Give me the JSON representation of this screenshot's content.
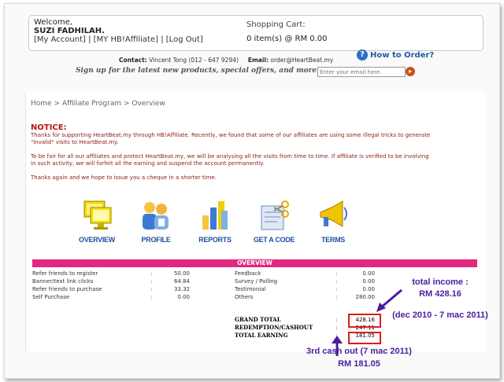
{
  "header": {
    "welcome": "Welcome,",
    "user": "SUZI FADHILAH.",
    "links": [
      "[My Account]",
      "[MY HB!Affiliate]",
      "[Log Out]"
    ],
    "link_sep": "|",
    "cart_title": "Shopping Cart:",
    "cart_summary": "0 item(s) @ RM 0.00"
  },
  "contact": {
    "label": "Contact:",
    "value": "Vincent Tong (012 - 647 9294)",
    "email_label": "Email:",
    "email": "order@HeartBeat.my"
  },
  "how_to_order": "How to Order?",
  "signup": {
    "text": "Sign up for the latest new products, special offers, and more:",
    "placeholder": "Enter your email here."
  },
  "breadcrumb": "Home > Affiliate Program > Overview",
  "notice": {
    "title": "NOTICE:",
    "p1": "Thanks for supporting HeartBeat.my through HB!Affiliate. Recently, we found that some of our affiliates are using some illegal tricks to generate \"invalid\" visits to HeartBeat.my.",
    "p2": "To be fair for all our affiliates and protect HeartBeat.my, we will be analysing all the visits from time to time. If affiliate is verified to be involving in such activity, we will forfeit all the earning and suspend the account permanently.",
    "p3": "Thanks again and we hope to issue you a cheque in a shorter time."
  },
  "nav": {
    "overview": "OVERVIEW",
    "profile": "PROFILE",
    "reports": "REPORTS",
    "get_code": "GET A CODE",
    "terms": "TERMS"
  },
  "overview": {
    "title": "OVERVIEW",
    "colon": ":",
    "left": [
      {
        "label": "Refer friends to register",
        "value": "50.00"
      },
      {
        "label": "Banner/text link clicks",
        "value": "64.84"
      },
      {
        "label": "Refer friends to purchase",
        "value": "33.32"
      },
      {
        "label": "Self Purchase",
        "value": "0.00"
      }
    ],
    "right": [
      {
        "label": "Feedback",
        "value": "0.00"
      },
      {
        "label": "Survey / Polling",
        "value": "0.00"
      },
      {
        "label": "Testimonial",
        "value": "0.00"
      },
      {
        "label": "Others",
        "value": "280.00"
      }
    ],
    "totals": [
      {
        "label": "GRAND TOTAL",
        "value": "428.16"
      },
      {
        "label": "REDEMPTION/CASHOUT",
        "value": "247.11"
      },
      {
        "label": "TOTAL EARNING",
        "value": "181.05"
      }
    ]
  },
  "annotations": {
    "income_line1": "total income :",
    "income_line2": "RM 428.16",
    "income_line3": "(dec 2010 - 7 mac 2011)",
    "cashout_line1": "3rd cash out (7 mac 2011)",
    "cashout_line2": "RM 181.05"
  },
  "colors": {
    "accent": "#e0287f",
    "annotation": "#4b1d9e",
    "highlight": "#e01b1b",
    "notice": "#c01010",
    "nav_label": "#1f4fa2"
  }
}
